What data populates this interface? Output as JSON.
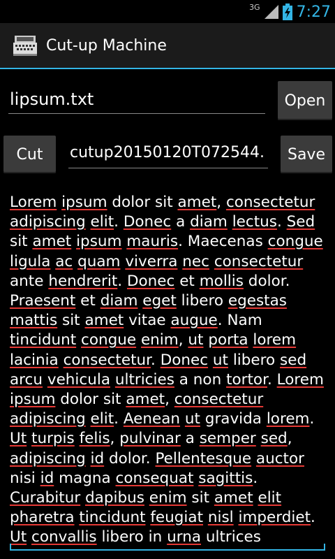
{
  "status": {
    "network": "3G",
    "time": "7:27"
  },
  "app": {
    "title": "Cut-up Machine",
    "icon": "typewriter-icon"
  },
  "input_file": {
    "value": "lipsum.txt",
    "button": "Open"
  },
  "cut": {
    "button": "Cut",
    "output_name": "cutup20150120T072544.",
    "save_button": "Save"
  },
  "body_text": "Lorem ipsum dolor sit amet, consectetur adipiscing elit. Donec a diam lectus. Sed sit amet ipsum mauris. Maecenas congue ligula ac quam viverra nec consectetur ante hendrerit. Donec et mollis dolor. Praesent et diam eget libero egestas mattis sit amet vitae augue. Nam tincidunt congue enim, ut porta lorem lacinia consectetur. Donec ut libero sed arcu vehicula ultricies a non tortor. Lorem ipsum dolor sit amet, consectetur adipiscing elit. Aenean ut gravida lorem. Ut turpis felis, pulvinar a semper sed, adipiscing id dolor. Pellentesque auctor nisi id magna consequat sagittis. Curabitur dapibus enim sit amet elit pharetra tincidunt feugiat nisl imperdiet. Ut convallis libero in urna ultrices",
  "spellcheck_words": [
    "Lorem",
    "ipsum",
    "amet",
    "consectetur",
    "adipiscing",
    "elit",
    "Donec",
    "diam",
    "lectus",
    "Sed",
    "mauris",
    "congue",
    "ligula",
    "ac",
    "quam",
    "viverra",
    "nec",
    "hendrerit",
    "mollis",
    "Praesent",
    "eget",
    "egestas",
    "mattis",
    "augue",
    "tincidunt",
    "enim",
    "ut",
    "porta",
    "lorem",
    "lacinia",
    "arcu",
    "vehicula",
    "ultricies",
    "tortor",
    "Aenean",
    "Ut",
    "turpis",
    "felis",
    "pulvinar",
    "semper",
    "sed",
    "id",
    "Pellentesque",
    "auctor",
    "consequat",
    "sagittis",
    "Curabitur",
    "dapibus",
    "pharetra",
    "feugiat",
    "nisl",
    "imperdiet",
    "convallis",
    "urna"
  ],
  "colors": {
    "accent": "#33b5e5",
    "spell_underline": "#e53935"
  }
}
